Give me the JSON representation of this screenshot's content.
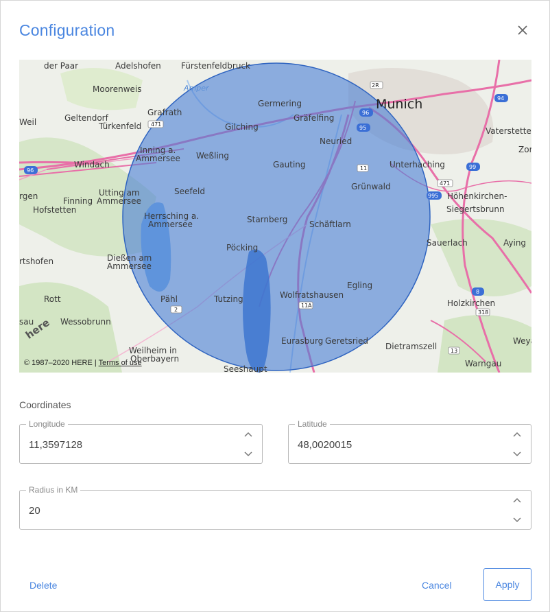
{
  "dialog": {
    "title": "Configuration",
    "close_icon": "close-icon"
  },
  "map": {
    "copyright": "© 1987–2020 HERE | ",
    "terms_label": "Terms of use",
    "logo": "here",
    "center_city": "Munich",
    "places": [
      "der Paar",
      "Adelshofen",
      "Fürstenfeldbruck",
      "Moorenweis",
      "Amper",
      "Germering",
      "Grafrath",
      "Geltendorf",
      "Weil",
      "Türkenfeld",
      "Gilching",
      "Gräfelfing",
      "Vaterstetten",
      "Neuried",
      "Zorn",
      "Inning a. Ammersee",
      "Weßling",
      "Windach",
      "Gauting",
      "Unterhaching",
      "Utting am Ammersee",
      "Seefeld",
      "Grünwald",
      "Finning",
      "rgen",
      "Hofstetten",
      "Höhenkirchen-Siegertsbrunn",
      "Herrsching a. Ammersee",
      "Starnberg",
      "Schäftlarn",
      "Sauerlach",
      "Aying",
      "Pöcking",
      "rtshofen",
      "Dießen am Ammersee",
      "Egling",
      "Rott",
      "Pähl",
      "Tutzing",
      "Wolfratshausen",
      "Holzkirchen",
      "sau",
      "Wessobrunn",
      "Eurasburg",
      "Geretsried",
      "Weya",
      "Dietramszell",
      "Weilheim in Oberbayern",
      "Seeshaupt",
      "Warngau"
    ],
    "shields": [
      "471",
      "96",
      "2R",
      "96",
      "95",
      "94",
      "11",
      "99",
      "471",
      "995",
      "2",
      "8",
      "11A",
      "318",
      "13"
    ],
    "circle_color": "#4a7fd6",
    "road_color": "#e86fa8"
  },
  "coordinates": {
    "section_label": "Coordinates",
    "longitude": {
      "label": "Longitude",
      "value": "11,3597128"
    },
    "latitude": {
      "label": "Latitude",
      "value": "48,0020015"
    },
    "radius": {
      "label": "Radius in KM",
      "value": "20"
    }
  },
  "actions": {
    "delete_label": "Delete",
    "cancel_label": "Cancel",
    "apply_label": "Apply"
  },
  "colors": {
    "accent": "#4a86e0",
    "border": "#b8b8b8"
  }
}
